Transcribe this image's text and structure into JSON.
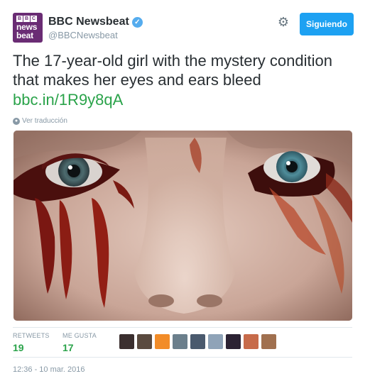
{
  "account": {
    "name": "BBC Newsbeat",
    "handle": "@BBCNewsbeat",
    "avatar_text": {
      "blocks": [
        "B",
        "B",
        "C"
      ],
      "line1": "news",
      "line2": "beat"
    },
    "verified_icon": "verified-badge-icon"
  },
  "actions": {
    "settings_icon": "gear-icon",
    "follow_label": "Siguiendo"
  },
  "tweet": {
    "text": "The 17-year-old girl with the mystery condition that makes her eyes and ears bleed",
    "link": "bbc.in/1R9y8qA",
    "translate_label": "Ver traducción"
  },
  "stats": {
    "retweets_label": "RETWEETS",
    "retweets_value": "19",
    "likes_label": "ME GUSTA",
    "likes_value": "17"
  },
  "likers": [
    {
      "color": "#3b2f2f"
    },
    {
      "color": "#5a4a3f"
    },
    {
      "color": "#f28c28"
    },
    {
      "color": "#6b7f8c"
    },
    {
      "color": "#4a5a6e"
    },
    {
      "color": "#8fa3b8"
    },
    {
      "color": "#2b2233"
    },
    {
      "color": "#c76b4a"
    },
    {
      "color": "#a0704f"
    }
  ],
  "timestamp": "12:36 - 10 mar. 2016",
  "colors": {
    "accent_green": "#2aa34a",
    "follow_blue": "#1da1f2",
    "avatar_purple": "#6a2c74"
  }
}
